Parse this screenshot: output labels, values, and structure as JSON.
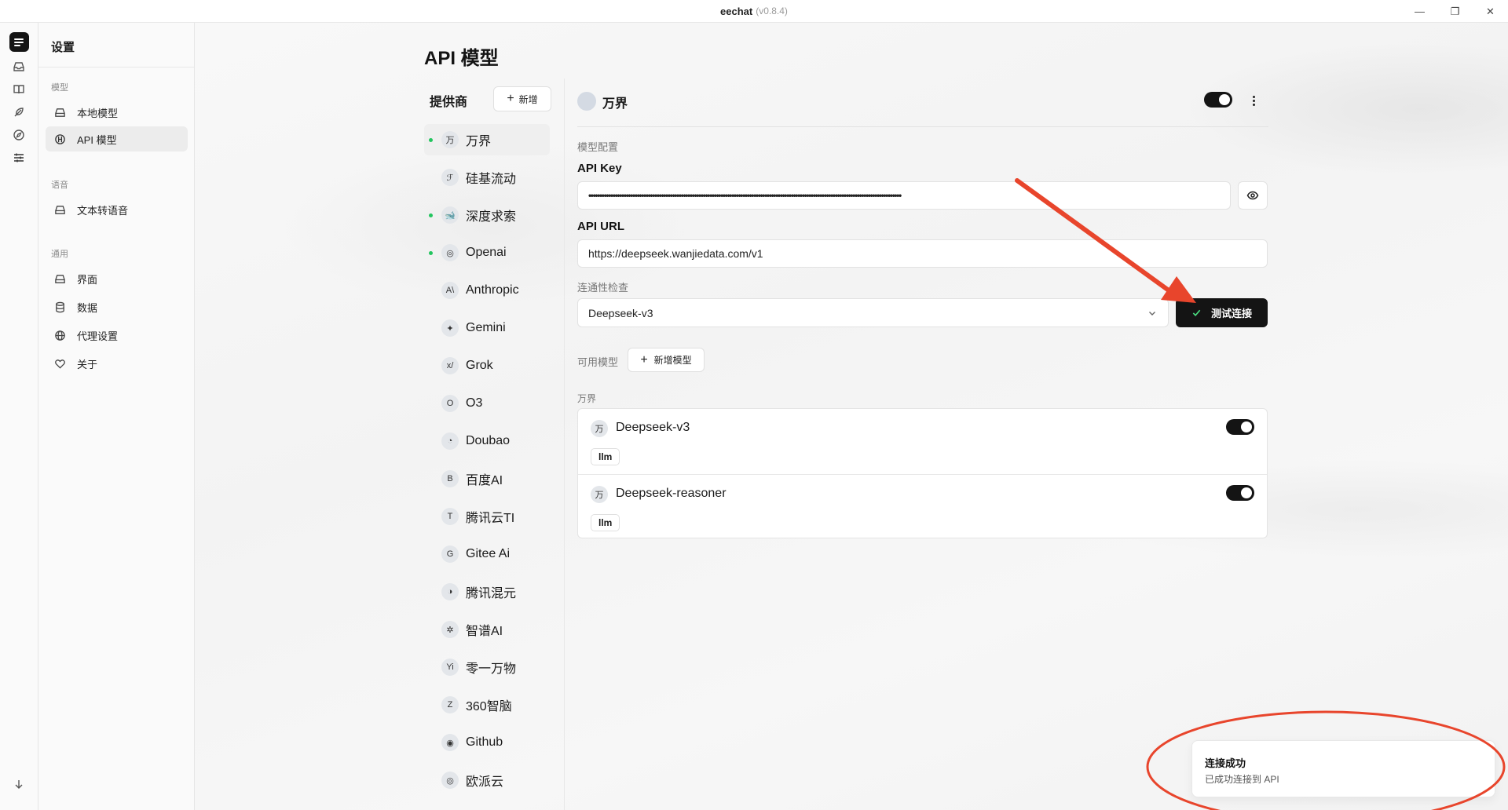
{
  "window": {
    "title": "eechat",
    "version": "(v0.8.4)",
    "controls": [
      "—",
      "❐",
      "✕"
    ]
  },
  "rail": {
    "icons": [
      "logo-icon",
      "inbox-icon",
      "book-icon",
      "feather-icon",
      "compass-icon",
      "sliders-icon",
      "arrow-down-icon"
    ]
  },
  "settings": {
    "title": "设置",
    "groups": [
      {
        "label": "模型",
        "items": [
          {
            "label": "本地模型",
            "icon": "drive-icon"
          },
          {
            "label": "API 模型",
            "icon": "api-icon"
          }
        ]
      },
      {
        "label": "语音",
        "items": [
          {
            "label": "文本转语音",
            "icon": "drive-icon"
          }
        ]
      },
      {
        "label": "通用",
        "items": [
          {
            "label": "界面",
            "icon": "drive-icon"
          },
          {
            "label": "数据",
            "icon": "database-icon"
          },
          {
            "label": "代理设置",
            "icon": "globe-icon"
          },
          {
            "label": "关于",
            "icon": "heart-icon"
          }
        ]
      }
    ]
  },
  "page": {
    "title": "API 模型"
  },
  "providers": {
    "heading": "提供商",
    "new_label": "新增",
    "items": [
      {
        "label": "万界",
        "badge": "万",
        "active": true,
        "online": true
      },
      {
        "label": "硅基流动",
        "badge": "ℱ",
        "online": false
      },
      {
        "label": "深度求索",
        "badge": "🐋",
        "online": true
      },
      {
        "label": "Openai",
        "badge": "◎",
        "online": true
      },
      {
        "label": "Anthropic",
        "badge": "A\\",
        "online": false
      },
      {
        "label": "Gemini",
        "badge": "✦",
        "online": false
      },
      {
        "label": "Grok",
        "badge": "x/",
        "online": false
      },
      {
        "label": "O3",
        "badge": "O",
        "online": false
      },
      {
        "label": "Doubao",
        "badge": "◔",
        "online": false
      },
      {
        "label": "百度AI",
        "badge": "B",
        "online": false
      },
      {
        "label": "腾讯云TI",
        "badge": "T",
        "online": false
      },
      {
        "label": "Gitee Ai",
        "badge": "G",
        "online": false
      },
      {
        "label": "腾讯混元",
        "badge": "◑",
        "online": false
      },
      {
        "label": "智谱AI",
        "badge": "✲",
        "online": false
      },
      {
        "label": "零一万物",
        "badge": "Yi",
        "online": false
      },
      {
        "label": "360智脑",
        "badge": "Z",
        "online": false
      },
      {
        "label": "Github",
        "badge": "◉",
        "online": false
      },
      {
        "label": "欧派云",
        "badge": "◎",
        "online": false
      }
    ]
  },
  "detail": {
    "provider_name": "万界",
    "enabled": true,
    "section_label": "模型配置",
    "api_key_label": "API Key",
    "api_key_value": "••••••••••••••••••••••••••••••••••••••••••••••••••••••••••••••••••••••••••••••••••••••••••••••••••••••••••••••••••••••••••••••••••••••••••••••",
    "api_url_label": "API URL",
    "api_url_value": "https://deepseek.wanjiedata.com/v1",
    "connectivity_label": "连通性检查",
    "connectivity_model": "Deepseek-v3",
    "test_button": "测试连接",
    "available_label": "可用模型",
    "add_model_button": "新增模型",
    "group_label": "万界",
    "models": [
      {
        "badge": "万",
        "name": "Deepseek-v3",
        "tag": "llm",
        "enabled": true
      },
      {
        "badge": "万",
        "name": "Deepseek-reasoner",
        "tag": "llm",
        "enabled": true
      }
    ]
  },
  "toast": {
    "title": "连接成功",
    "message": "已成功连接到 API"
  },
  "colors": {
    "accent": "#141414",
    "online_dot": "#22c55e",
    "annotation": "#e8452c"
  }
}
